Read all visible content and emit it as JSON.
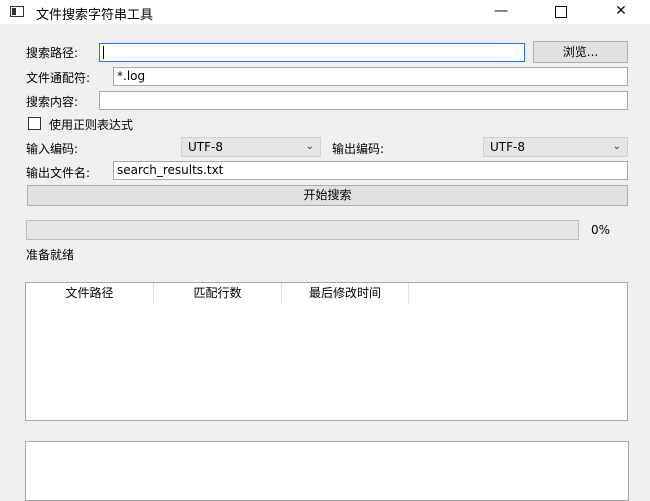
{
  "window": {
    "title": "文件搜索字符串工具",
    "min_glyph": "—",
    "close_glyph": "✕"
  },
  "form": {
    "search_path": {
      "label": "搜索路径:",
      "value": ""
    },
    "browse_label": "浏览...",
    "wildcard": {
      "label": "文件通配符:",
      "value": "*.log"
    },
    "content": {
      "label": "搜索内容:",
      "value": ""
    },
    "regex": {
      "label": "使用正则表达式",
      "checked": false
    },
    "input_encoding": {
      "label": "输入编码:",
      "value": "UTF-8"
    },
    "output_encoding": {
      "label": "输出编码:",
      "value": "UTF-8"
    },
    "output_file": {
      "label": "输出文件名:",
      "value": "search_results.txt"
    },
    "start_button": "开始搜索"
  },
  "progress": {
    "value": 0,
    "text": "0%"
  },
  "status": {
    "text": "准备就绪"
  },
  "results": {
    "columns": [
      "文件路径",
      "匹配行数",
      "最后修改时间"
    ],
    "rows": []
  },
  "icons": {
    "app": "app-window-icon",
    "combo": "chevron-down-icon"
  }
}
